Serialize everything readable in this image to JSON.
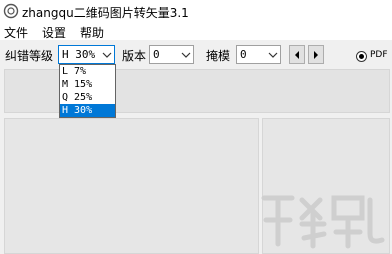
{
  "window": {
    "title": "zhangqu二维码图片转矢量3.1"
  },
  "menu": {
    "items": [
      "文件",
      "设置",
      "帮助"
    ]
  },
  "toolbar": {
    "ecc_label": "纠错等级",
    "ecc_value": "H 30%",
    "version_label": "版本",
    "version_value": "0",
    "mask_label": "掩模",
    "mask_value": "0",
    "pdf_label": "PDF"
  },
  "dropdown": {
    "options": [
      "L 7%",
      "M 15%",
      "Q 25%",
      "H 30%"
    ],
    "selected": "H 30%"
  },
  "colors": {
    "accent": "#0078d7",
    "panel": "#e6e6e6"
  }
}
